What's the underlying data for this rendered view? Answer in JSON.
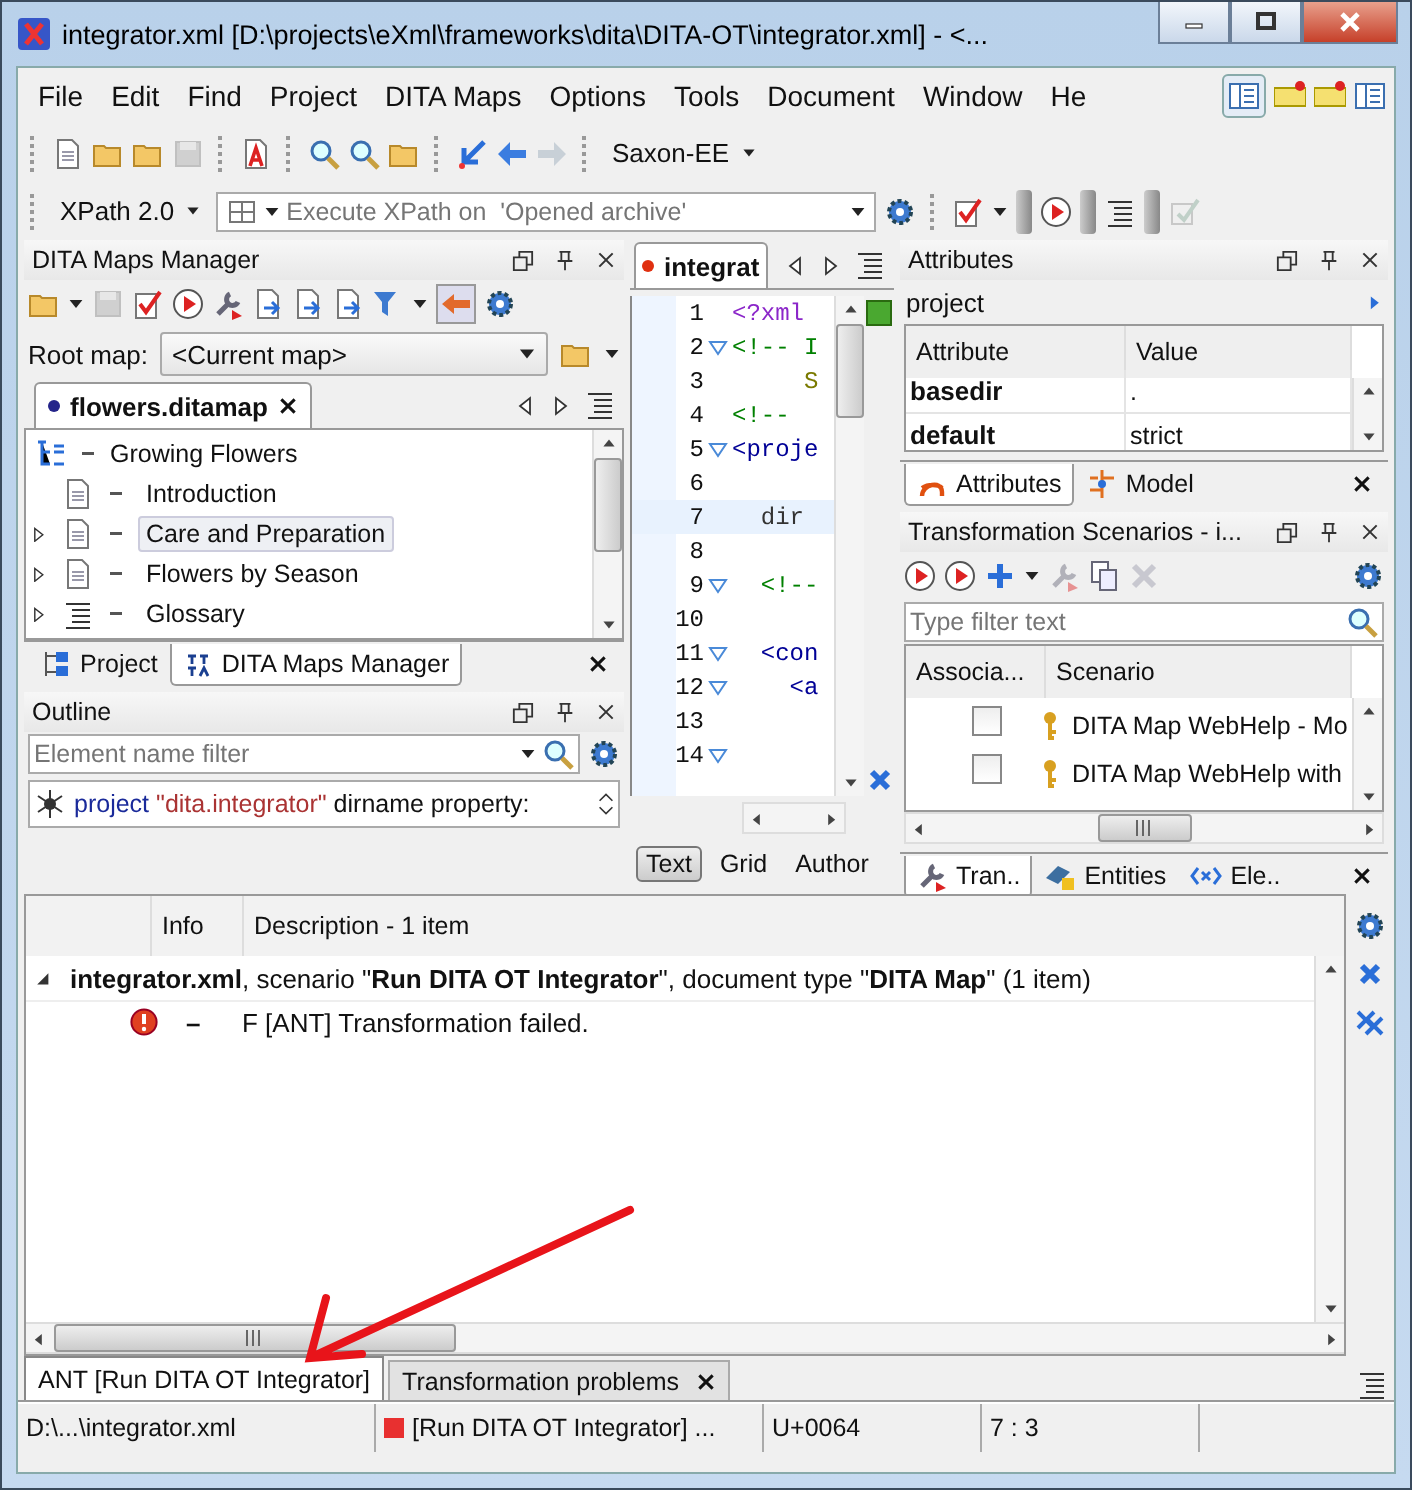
{
  "window": {
    "title": "integrator.xml [D:\\projects\\eXml\\frameworks\\dita\\DITA-OT\\integrator.xml] - <..."
  },
  "menu": [
    "File",
    "Edit",
    "Find",
    "Project",
    "DITA Maps",
    "Options",
    "Tools",
    "Document",
    "Window",
    "He"
  ],
  "toolbar": {
    "processor": "Saxon-EE",
    "xpath_version": "XPath 2.0",
    "xpath_placeholder": "Execute XPath on  'Opened archive'"
  },
  "dita_maps_manager": {
    "title": "DITA Maps Manager",
    "root_map_label": "Root map:",
    "root_map_value": "<Current map>",
    "map_tab": {
      "label": "flowers.ditamap",
      "modified": true
    },
    "tree": {
      "label": "Growing Flowers",
      "kind": "map",
      "children": [
        {
          "label": "Introduction",
          "kind": "topic",
          "has_children": false,
          "selected": false
        },
        {
          "label": "Care and Preparation",
          "kind": "topic",
          "has_children": true,
          "selected": true
        },
        {
          "label": "Flowers by Season",
          "kind": "topic",
          "has_children": true,
          "selected": false
        },
        {
          "label": "Glossary",
          "kind": "glossary",
          "has_children": true,
          "selected": false
        }
      ]
    },
    "tabs": [
      {
        "label": "Project",
        "selected": false
      },
      {
        "label": "DITA Maps Manager",
        "selected": true
      }
    ]
  },
  "outline": {
    "title": "Outline",
    "filter_placeholder": "Element name filter",
    "node": {
      "element": "project",
      "value": "\"dita.integrator\"",
      "rest": "dirname property:"
    }
  },
  "editor": {
    "tab": {
      "label": "integrat",
      "modified": true
    },
    "lines": [
      {
        "number": "1",
        "text": "<?xml",
        "kind": "pi",
        "foldable": false,
        "current": false
      },
      {
        "number": "2",
        "text": "<!-- I",
        "kind": "comment",
        "foldable": true,
        "current": false
      },
      {
        "number": "3",
        "text": "     S",
        "kind": "text",
        "foldable": false,
        "current": false
      },
      {
        "number": "4",
        "text": "<!--",
        "kind": "comment",
        "foldable": false,
        "current": false
      },
      {
        "number": "5",
        "text": "<proje",
        "kind": "tag",
        "foldable": true,
        "current": false
      },
      {
        "number": "6",
        "foldable": false,
        "current": false
      },
      {
        "number": "7",
        "text": "  dir",
        "kind": "attr",
        "foldable": false,
        "current": true
      },
      {
        "number": "8",
        "foldable": false,
        "current": false
      },
      {
        "number": "9",
        "text": "  <!--",
        "kind": "comment",
        "foldable": true,
        "current": false
      },
      {
        "number": "10",
        "foldable": false,
        "current": false
      },
      {
        "number": "11",
        "text": "  <con",
        "kind": "tag",
        "foldable": true,
        "current": false
      },
      {
        "number": "12",
        "text": "    <a",
        "kind": "tag",
        "foldable": true,
        "current": false
      },
      {
        "number": "13",
        "foldable": false,
        "current": false
      },
      {
        "number": "14",
        "foldable": true,
        "current": false
      }
    ],
    "modes": [
      {
        "label": "Text",
        "selected": true
      },
      {
        "label": "Grid",
        "selected": false
      },
      {
        "label": "Author",
        "selected": false
      }
    ]
  },
  "attributes": {
    "title": "Attributes",
    "element": "project",
    "columns": [
      "Attribute",
      "Value"
    ],
    "rows": [
      {
        "name": "basedir",
        "value": "."
      },
      {
        "name": "default",
        "value": "strict"
      }
    ],
    "tabs": [
      {
        "label": "Attributes",
        "selected": true
      },
      {
        "label": "Model",
        "selected": false
      }
    ]
  },
  "scenarios": {
    "title": "Transformation Scenarios - i...",
    "filter_placeholder": "Type filter text",
    "columns": [
      "Associa...",
      "Scenario"
    ],
    "rows": [
      {
        "checked": false,
        "name": "DITA Map WebHelp - Mo"
      },
      {
        "checked": false,
        "name": "DITA Map WebHelp with"
      }
    ],
    "tabs": [
      {
        "label": "Tran..",
        "selected": true
      },
      {
        "label": "Entities",
        "selected": false
      },
      {
        "label": "Ele..",
        "selected": false
      }
    ]
  },
  "results": {
    "columns": [
      "Info",
      "Description - 1 item"
    ],
    "group": {
      "text": "**integrator.xml**, scenario \"**Run DITA OT Integrator**\", document type \"**DITA Map**\" (1 item)",
      "expanded": true
    },
    "rows": [
      {
        "kind": "error",
        "marker": "–",
        "description": "F [ANT] Transformation failed."
      }
    ]
  },
  "output_tabs": [
    {
      "label": "ANT [Run DITA OT Integrator]",
      "selected": true,
      "closable": false
    },
    {
      "label": "Transformation problems",
      "selected": false,
      "closable": true
    }
  ],
  "status_bar": [
    {
      "text": "D:\\...\\integrator.xml",
      "error": false
    },
    {
      "text": "[Run DITA OT Integrator] ...",
      "error": true
    },
    {
      "text": "U+0064",
      "error": false
    },
    {
      "text": "7 : 3",
      "error": false
    }
  ]
}
